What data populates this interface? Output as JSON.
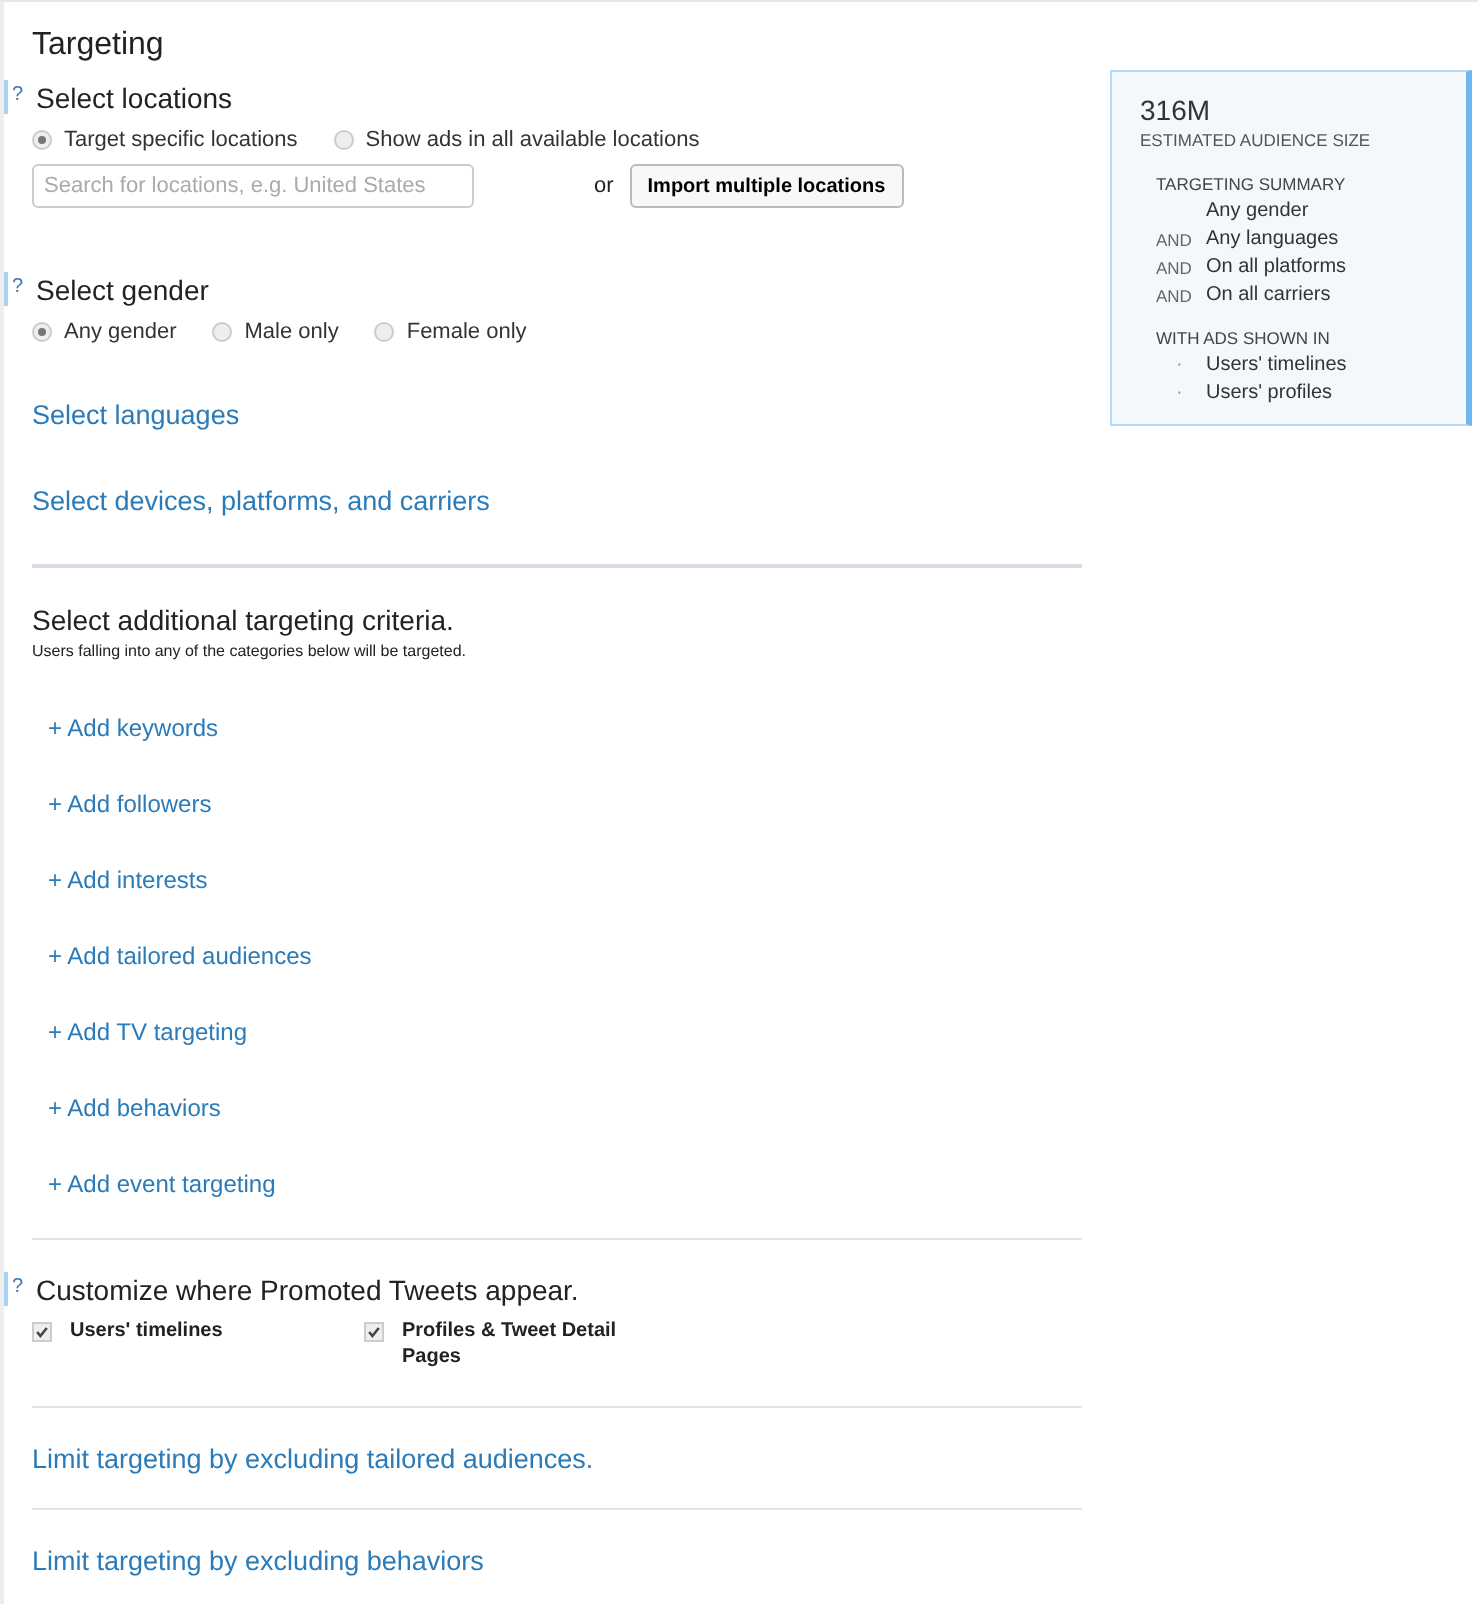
{
  "title": "Targeting",
  "locations": {
    "heading": "Select locations",
    "help": "?",
    "options": [
      {
        "label": "Target specific locations",
        "selected": true
      },
      {
        "label": "Show ads in all available locations",
        "selected": false
      }
    ],
    "search": {
      "placeholder": "Search for locations, e.g. United States"
    },
    "or": "or",
    "import_button": "Import multiple locations"
  },
  "gender": {
    "heading": "Select gender",
    "help": "?",
    "options": [
      {
        "label": "Any gender",
        "selected": true
      },
      {
        "label": "Male only",
        "selected": false
      },
      {
        "label": "Female only",
        "selected": false
      }
    ]
  },
  "links": [
    "Select languages",
    "Select devices, platforms, and carriers"
  ],
  "additional": {
    "heading": "Select additional targeting criteria.",
    "subtitle": "Users falling into any of the categories below will be targeted.",
    "items": [
      "+ Add keywords",
      "+ Add followers",
      "+ Add interests",
      "+ Add tailored audiences",
      "+ Add TV targeting",
      "+ Add behaviors",
      "+ Add event targeting"
    ]
  },
  "placement": {
    "heading": "Customize where Promoted Tweets appear.",
    "help": "?",
    "options": [
      {
        "label": "Users' timelines",
        "checked": true
      },
      {
        "label": "Profiles & Tweet Detail Pages",
        "checked": true
      }
    ]
  },
  "exclusions": [
    "Limit targeting by excluding tailored audiences.",
    "Limit targeting by excluding behaviors"
  ],
  "summary": {
    "size": "316M",
    "size_label": "ESTIMATED AUDIENCE SIZE",
    "summary_label": "TARGETING SUMMARY",
    "lines": [
      {
        "text": "Any gender"
      },
      {
        "connector": "AND",
        "text": "Any languages"
      },
      {
        "connector": "AND",
        "text": "On all platforms"
      },
      {
        "connector": "AND",
        "text": "On all carriers"
      }
    ],
    "shown_label": "WITH ADS SHOWN IN",
    "shown": [
      {
        "bullet": "·",
        "text": "Users' timelines"
      },
      {
        "bullet": "·",
        "text": "Users' profiles"
      }
    ]
  }
}
